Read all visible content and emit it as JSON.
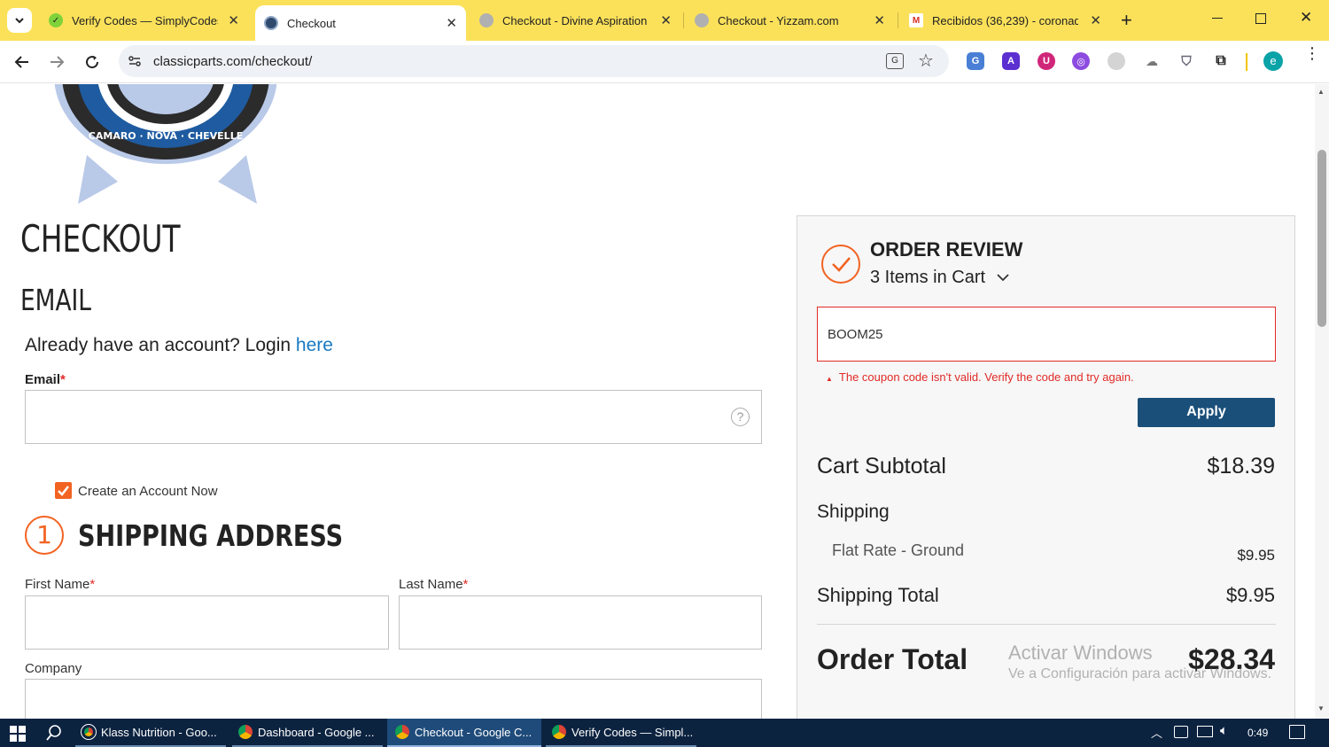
{
  "browser": {
    "tabs": [
      {
        "title": "Verify Codes — SimplyCodes",
        "active": false,
        "icon": "simplycodes-icon"
      },
      {
        "title": "Checkout",
        "active": true,
        "icon": "classicparts-icon"
      },
      {
        "title": "Checkout - Divine Aspiration",
        "active": false,
        "icon": "globe-icon"
      },
      {
        "title": "Checkout - Yizzam.com",
        "active": false,
        "icon": "globe-icon"
      },
      {
        "title": "Recibidos (36,239) - coronado",
        "active": false,
        "icon": "gmail-icon"
      }
    ],
    "new_tab": "+",
    "url": "classicparts.com/checkout/",
    "profile_initial": "e"
  },
  "page": {
    "logo_text": "CAMARO · NOVA · CHEVELLE",
    "checkout_title": "CHECKOUT",
    "email_section_title": "EMAIL",
    "account_prompt": "Already have an account? Login",
    "account_link": "here",
    "email_label": "Email",
    "create_account_label": "Create an Account Now",
    "create_account_checked": true,
    "shipping_step_number": "1",
    "shipping_title": "SHIPPING ADDRESS",
    "first_name_label": "First Name",
    "last_name_label": "Last Name",
    "company_label": "Company",
    "required_mark": "*"
  },
  "review": {
    "title": "ORDER REVIEW",
    "items_in_cart": "3 Items in Cart",
    "coupon_value": "BOOM25",
    "coupon_error": "The coupon code isn't valid. Verify the code and try again.",
    "apply_label": "Apply",
    "cart_subtotal_label": "Cart Subtotal",
    "cart_subtotal_value": "$18.39",
    "shipping_label": "Shipping",
    "shipping_method": "Flat Rate - Ground",
    "shipping_method_value": "$9.95",
    "shipping_total_label": "Shipping Total",
    "shipping_total_value": "$9.95",
    "order_total_label": "Order Total",
    "order_total_value": "$28.34"
  },
  "watermark": {
    "line1": "Activar Windows",
    "line2": "Ve a Configuración para activar Windows."
  },
  "taskbar": {
    "apps": [
      {
        "title": "Klass Nutrition - Goo...",
        "active": false
      },
      {
        "title": "Dashboard - Google ...",
        "active": false
      },
      {
        "title": "Checkout - Google C...",
        "active": true
      },
      {
        "title": "Verify Codes — Simpl...",
        "active": false
      }
    ],
    "time": "0:49"
  },
  "colors": {
    "tab_strip": "#fbe15a",
    "accent_orange": "#f26322",
    "apply_button": "#1a4f7a",
    "error_red": "#e02b27",
    "link_blue": "#1979c3",
    "taskbar": "#0c2340"
  }
}
